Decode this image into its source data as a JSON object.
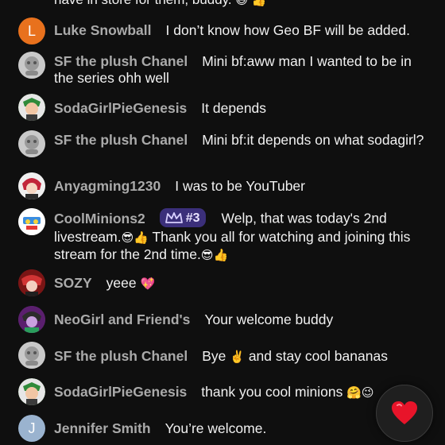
{
  "partial_message": "have in store for them, buddy.",
  "messages": [
    {
      "author": "Luke Snowball",
      "text": "I don’t know how Geo BF will be added.",
      "avatar": "L"
    },
    {
      "author": "SF the plush Chanel",
      "text": "Mini bf:aww man I wanted to be in the series ohh well"
    },
    {
      "author": "SodaGirlPieGenesis",
      "text": "It depends"
    },
    {
      "author": "SF the plush Chanel",
      "text": "Mini bf:it depends on what sodagirl?"
    },
    {
      "author": "Anyagming1230",
      "text": "I was to be YouTuber"
    },
    {
      "author": "CoolMinions2",
      "badge": "#3",
      "text_a": "Welp, that was today's 2nd livestream.",
      "text_b": "Thank you all for watching and joining this stream for the 2nd time."
    },
    {
      "author": "SOZY",
      "text": "yeee"
    },
    {
      "author": "NeoGirl and Friend's",
      "text": "Your welcome buddy"
    },
    {
      "author": "SF the plush Chanel",
      "text_a": "Bye",
      "text_b": "and stay cool bananas"
    },
    {
      "author": "SodaGirlPieGenesis",
      "text": "thank you cool minions"
    },
    {
      "author": "Jennifer Smith",
      "text": "You’re welcome.",
      "avatar": "J"
    }
  ],
  "icons": {
    "heart_button": "heart-icon",
    "badge": "crown-icon"
  },
  "colors": {
    "background": "#0f0f0f",
    "author": "#aaaaaa",
    "badge_bg": "#3b2f7a",
    "heart": "#e8142a"
  }
}
